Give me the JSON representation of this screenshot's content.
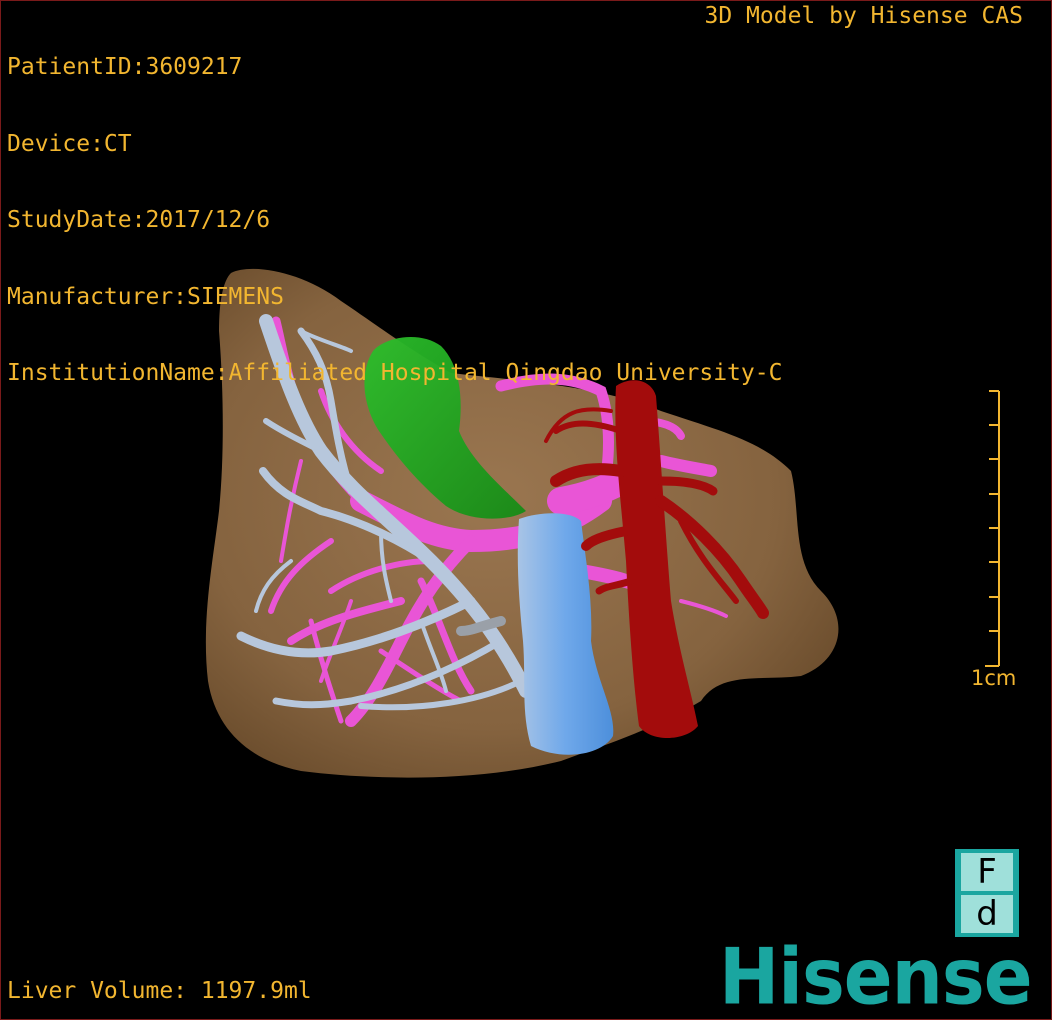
{
  "header": {
    "patient_id": "PatientID:3609217",
    "device": "Device:CT",
    "study_date": "StudyDate:2017/12/6",
    "manufacturer": "Manufacturer:SIEMENS",
    "institution": "InstitutionName:Affiliated Hospital Qingdao University-C"
  },
  "credit": "3D Model by Hisense CAS",
  "footer": {
    "liver_volume": "Liver Volume: 1197.9ml"
  },
  "scale_bar": {
    "label": "1cm"
  },
  "logo": {
    "badge_top": "F",
    "badge_bottom": "d",
    "brand": "Hisense"
  },
  "colors": {
    "text": "#f2b630",
    "liver": "#8c6a43",
    "hepatic_vein": "#b7c7dc",
    "portal_vein": "#e955d6",
    "gallbladder": "#1fa51f",
    "ivc": "#6fa8ea",
    "aorta": "#a30c0c",
    "brand": "#1aa6a0"
  }
}
